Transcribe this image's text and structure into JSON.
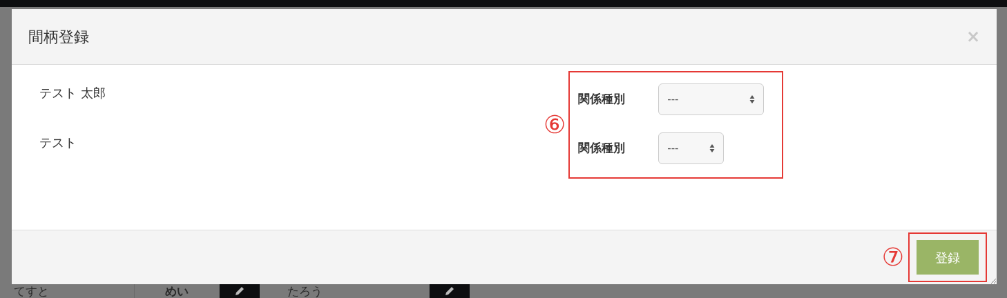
{
  "background_row": [
    {
      "kind": "text",
      "text": "てすと",
      "bold": false
    },
    {
      "kind": "text",
      "text": "めい",
      "bold": true
    },
    {
      "kind": "edit"
    },
    {
      "kind": "text",
      "text": "たろう",
      "bold": false
    },
    {
      "kind": "edit"
    }
  ],
  "modal": {
    "title": "間柄登録",
    "close": "×",
    "persons": [
      "テスト 太郎",
      "テスト"
    ],
    "fields": [
      {
        "label": "関係種別",
        "value": "---"
      },
      {
        "label": "関係種別",
        "value": "---"
      }
    ],
    "fields_marker": "⑥",
    "submit_marker": "⑦",
    "submit": "登録"
  }
}
